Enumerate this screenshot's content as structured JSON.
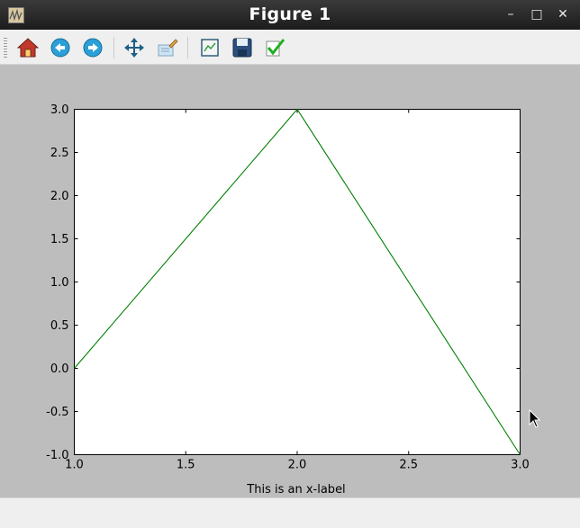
{
  "window": {
    "title": "Figure 1",
    "minimize_glyph": "–",
    "maximize_glyph": "□",
    "close_glyph": "✕"
  },
  "toolbar": {
    "items": [
      {
        "name": "home-icon"
      },
      {
        "name": "back-arrow-icon"
      },
      {
        "name": "forward-arrow-icon"
      },
      {
        "name": "pan-icon"
      },
      {
        "name": "zoom-icon"
      },
      {
        "name": "configure-subplots-icon"
      },
      {
        "name": "save-icon"
      },
      {
        "name": "edit-checkmark-icon"
      }
    ]
  },
  "chart_data": {
    "type": "line",
    "title": "",
    "xlabel": "This is an x-label",
    "ylabel": "",
    "xlim": [
      1.0,
      3.0
    ],
    "ylim": [
      -1.0,
      3.0
    ],
    "xticks": [
      "1.0",
      "1.5",
      "2.0",
      "2.5",
      "3.0"
    ],
    "yticks": [
      "-1.0",
      "-0.5",
      "0.0",
      "0.5",
      "1.0",
      "1.5",
      "2.0",
      "2.5",
      "3.0"
    ],
    "grid": false,
    "series": [
      {
        "x": [
          1,
          2,
          3
        ],
        "y": [
          0,
          3,
          -1
        ],
        "color": "#008000"
      }
    ]
  },
  "colors": {
    "figure_bg": "#bdbdbd",
    "axes_bg": "#ffffff",
    "line": "#008000"
  }
}
